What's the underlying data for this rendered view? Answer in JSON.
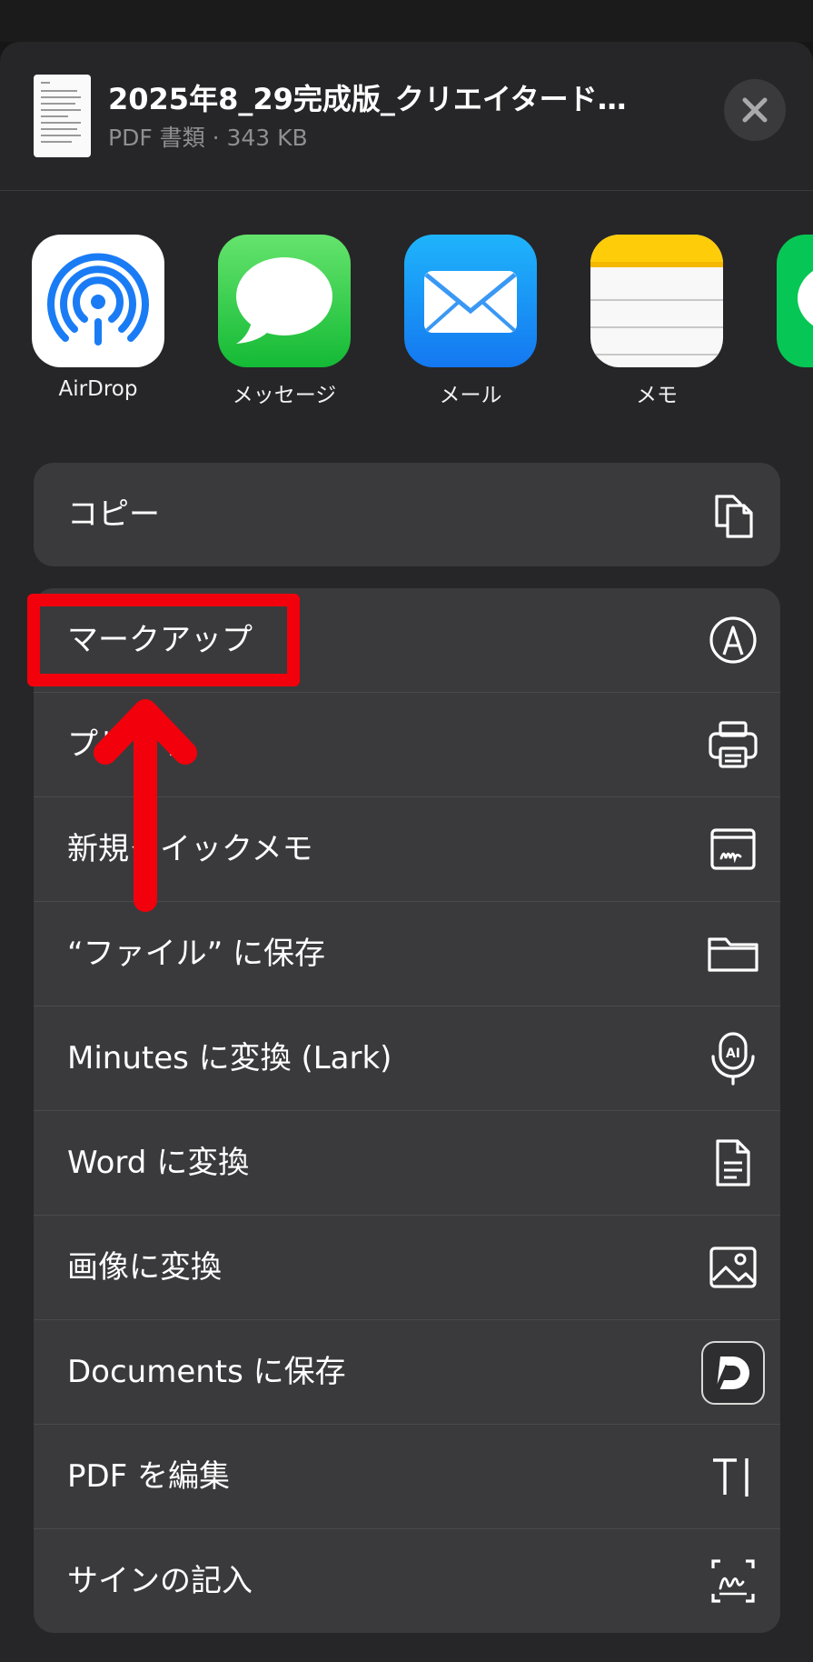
{
  "file": {
    "title": "2025年8_29完成版_クリエイタード…",
    "meta": "PDF 書類 · 343 KB"
  },
  "apps": [
    {
      "label": "AirDrop",
      "icon": "airdrop-icon"
    },
    {
      "label": "メッセージ",
      "icon": "messages-icon"
    },
    {
      "label": "メール",
      "icon": "mail-icon"
    },
    {
      "label": "メモ",
      "icon": "notes-icon"
    },
    {
      "label": "",
      "icon": "line-app-icon"
    }
  ],
  "actions_group1": [
    {
      "label": "コピー",
      "icon": "copy-icon"
    }
  ],
  "actions_group2": [
    {
      "label": "マークアップ",
      "icon": "markup-icon"
    },
    {
      "label": "プリント",
      "icon": "print-icon"
    },
    {
      "label": "新規クイックメモ",
      "icon": "quick-note-icon"
    },
    {
      "label": "“ファイル” に保存",
      "icon": "folder-icon"
    },
    {
      "label": "Minutes に変換 (Lark)",
      "icon": "ai-mic-icon"
    },
    {
      "label": "Word に変換",
      "icon": "document-icon"
    },
    {
      "label": "画像に変換",
      "icon": "image-icon"
    },
    {
      "label": "Documents に保存",
      "icon": "documents-app-icon"
    },
    {
      "label": "PDF を編集",
      "icon": "text-cursor-icon"
    },
    {
      "label": "サインの記入",
      "icon": "signature-icon"
    }
  ],
  "colors": {
    "sheet": "#262628",
    "row": "#3a3a3c",
    "highlight": "#f2000c"
  }
}
